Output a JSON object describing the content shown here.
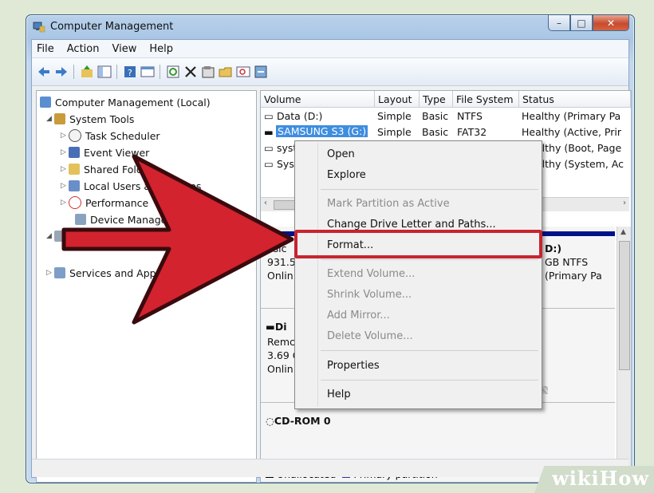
{
  "window": {
    "title": "Computer Management"
  },
  "menu": [
    "File",
    "Action",
    "View",
    "Help"
  ],
  "tree": {
    "root": "Computer Management (Local)",
    "system_tools": "System Tools",
    "task_scheduler": "Task Scheduler",
    "event_viewer": "Event Viewer",
    "shared_folders": "Shared Folders",
    "local_users": "Local Users and Groups",
    "performance": "Performance",
    "device_manager": "Device Manager",
    "services": "Services and Applications"
  },
  "volume_table": {
    "columns": [
      "Volume",
      "Layout",
      "Type",
      "File System",
      "Status"
    ],
    "rows": [
      {
        "volume": "Data (D:)",
        "layout": "Simple",
        "type": "Basic",
        "fs": "NTFS",
        "status": "Healthy (Primary Pa"
      },
      {
        "volume": "SAMSUNG S3 (G:)",
        "layout": "Simple",
        "type": "Basic",
        "fs": "FAT32",
        "status": "Healthy (Active, Prir"
      },
      {
        "volume": "syst",
        "layout": "",
        "type": "",
        "fs": "",
        "status": "althy (Boot, Page"
      },
      {
        "volume": "Sys",
        "layout": "",
        "type": "",
        "fs": "",
        "status": "althy (System, Ac"
      }
    ]
  },
  "disks": {
    "disk0": {
      "type": "asic",
      "size": "931.5",
      "status": "Onlin",
      "part_label": "D:)",
      "part_size": "GB NTFS",
      "part_status": "(Primary Pa"
    },
    "disk1": {
      "name": "Di",
      "type": "Remc",
      "size": "3.69 C",
      "status": "Onlin"
    },
    "cdrom": "CD-ROM 0"
  },
  "legend": {
    "unallocated": "Unallocated",
    "primary": "Primary partition"
  },
  "context_menu": {
    "open": "Open",
    "explore": "Explore",
    "mark_active": "Mark Partition as Active",
    "change_letter": "Change Drive Letter and Paths...",
    "format": "Format...",
    "extend": "Extend Volume...",
    "shrink": "Shrink Volume...",
    "add_mirror": "Add Mirror...",
    "delete": "Delete Volume...",
    "properties": "Properties",
    "help": "Help"
  },
  "colors": {
    "highlight": "#c7242f",
    "arrow": "#d2232e",
    "selection": "#3e8de0"
  },
  "watermark": "wikiHow"
}
